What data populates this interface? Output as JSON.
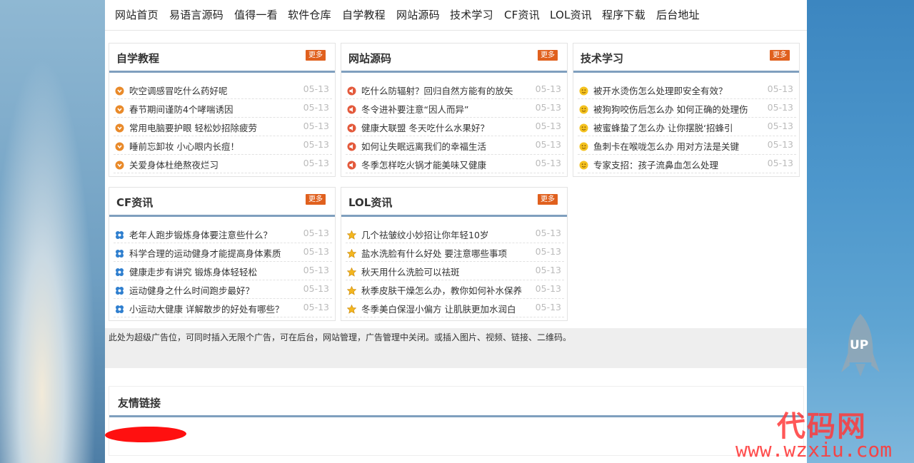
{
  "nav": [
    "网站首页",
    "易语言源码",
    "值得一看",
    "软件仓库",
    "自学教程",
    "网站源码",
    "技术学习",
    "CF资讯",
    "LOL资讯",
    "程序下载",
    "后台地址"
  ],
  "more_label": "更多",
  "sections": [
    {
      "title": "自学教程",
      "icon": "orange-circle-icon",
      "items": [
        {
          "text": "吹空调感冒吃什么药好呢",
          "date": "05-13"
        },
        {
          "text": "春节期间谨防4个哮喘诱因",
          "date": "05-13"
        },
        {
          "text": "常用电脑要护眼 轻松妙招除疲劳",
          "date": "05-13"
        },
        {
          "text": "睡前忘卸妆 小心眼内长痘！",
          "date": "05-13"
        },
        {
          "text": "关爱身体杜绝熬夜烂习",
          "date": "05-13"
        }
      ]
    },
    {
      "title": "网站源码",
      "icon": "speaker-icon",
      "items": [
        {
          "text": "吃什么防辐射？回归自然方能有的放矢",
          "date": "05-13"
        },
        {
          "text": "冬令进补要注意“因人而异”",
          "date": "05-13"
        },
        {
          "text": "健康大联盟 冬天吃什么水果好？",
          "date": "05-13"
        },
        {
          "text": "如何让失眠远离我们的幸福生活",
          "date": "05-13"
        },
        {
          "text": "冬季怎样吃火锅才能美味又健康",
          "date": "05-13"
        }
      ]
    },
    {
      "title": "技术学习",
      "icon": "smiley-icon",
      "items": [
        {
          "text": "被开水烫伤怎么处理即安全有效？",
          "date": "05-13"
        },
        {
          "text": "被狗狗咬伤后怎么办 如何正确的处理伤",
          "date": "05-13"
        },
        {
          "text": "被蜜蜂蛰了怎么办 让你摆脱‘招蜂引",
          "date": "05-13"
        },
        {
          "text": "鱼刺卡在喉咙怎么办 用对方法是关键",
          "date": "05-13"
        },
        {
          "text": "专家支招：孩子流鼻血怎么处理",
          "date": "05-13"
        }
      ]
    },
    {
      "title": "CF资讯",
      "icon": "flower-icon",
      "items": [
        {
          "text": "老年人跑步锻炼身体要注意些什么？",
          "date": "05-13"
        },
        {
          "text": "科学合理的运动健身才能提高身体素质",
          "date": "05-13"
        },
        {
          "text": "健康走步有讲究 锻炼身体轻轻松",
          "date": "05-13"
        },
        {
          "text": "运动健身之什么时间跑步最好？",
          "date": "05-13"
        },
        {
          "text": "小运动大健康 详解散步的好处有哪些？",
          "date": "05-13"
        }
      ]
    },
    {
      "title": "LOL资讯",
      "icon": "star-icon",
      "items": [
        {
          "text": "几个祛皱纹小妙招让你年轻10岁",
          "date": "05-13"
        },
        {
          "text": "盐水洗脸有什么好处 要注意哪些事项",
          "date": "05-13"
        },
        {
          "text": "秋天用什么洗脸可以祛斑",
          "date": "05-13"
        },
        {
          "text": "秋季皮肤干燥怎么办，教你如何补水保养",
          "date": "05-13"
        },
        {
          "text": "冬季美白保湿小偏方 让肌肤更加水润白",
          "date": "05-13"
        }
      ]
    }
  ],
  "ad_text": "此处为超级广告位，可同时插入无限个广告，可在后台，网站管理，广告管理中关闭。或插入图片、视频、链接、二维码。",
  "links_title": "友情链接",
  "up_label": "UP",
  "watermark_cn": "代码网",
  "watermark_url": "www.wzxiu.com",
  "colors": {
    "accent": "#e0601e",
    "header_line": "#7f9fbe"
  }
}
